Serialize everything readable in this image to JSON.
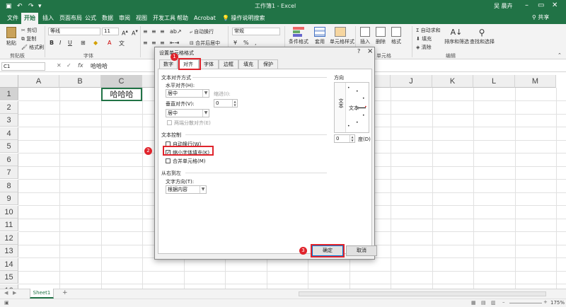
{
  "titlebar": {
    "window_title": "工作簿1 - Excel",
    "user": "吴 晨卉",
    "share": "共享",
    "tell_me": "操作说明搜索",
    "tabs": [
      "文件",
      "开始",
      "插入",
      "页面布局",
      "公式",
      "数据",
      "审阅",
      "视图",
      "开发工具",
      "帮助",
      "Acrobat"
    ]
  },
  "ribbon": {
    "clipboard": {
      "paste": "粘贴",
      "cut": "剪切",
      "copy": "复制",
      "format_painter": "格式刷",
      "group": "剪贴板"
    },
    "font": {
      "name": "等线",
      "size": "11",
      "group": "字体"
    },
    "alignment": {
      "wrap": "自动换行",
      "merge": "合并后居中"
    },
    "number": {
      "format": "常规"
    },
    "styles": {
      "conditional": "条件格式",
      "table": "套用",
      "cell_styles": "单元格样式"
    },
    "cells": {
      "insert": "插入",
      "delete": "删除",
      "format": "格式",
      "group": "单元格"
    },
    "editing": {
      "autosum": "自动求和",
      "fill": "填充",
      "clear": "清除",
      "sort": "排序和筛选",
      "find": "查找和选择",
      "group": "编辑"
    }
  },
  "formula_bar": {
    "name_box": "C1",
    "fx": "fx",
    "content": "哈哈哈"
  },
  "grid": {
    "columns": [
      "A",
      "B",
      "C",
      "D",
      "E",
      "F",
      "G",
      "H",
      "I",
      "J",
      "K",
      "L",
      "M"
    ],
    "rows": [
      "1",
      "2",
      "3",
      "4",
      "5",
      "6",
      "7",
      "8",
      "9",
      "10",
      "11",
      "12",
      "13",
      "14",
      "15",
      "16"
    ],
    "cell_c1": "哈哈哈"
  },
  "sheets": {
    "tab": "Sheet1",
    "add": "+"
  },
  "status": {
    "zoom": "175%"
  },
  "dialog": {
    "title": "设置单元格格式",
    "help": "?",
    "close": "×",
    "tabs": [
      "数字",
      "对齐",
      "字体",
      "边框",
      "填充",
      "保护"
    ],
    "text_alignment": {
      "section": "文本对齐方式",
      "horizontal_label": "水平对齐(H):",
      "horizontal_value": "居中",
      "indent_label": "缩进(I):",
      "indent_value": "0",
      "vertical_label": "垂直对齐(V):",
      "vertical_value": "居中",
      "justify_distributed": "两端分散对齐(E)"
    },
    "orientation": {
      "label": "方向",
      "vertical_text": "文本",
      "rotated_text": "文本",
      "degrees": "度(D)",
      "degree_value": "0"
    },
    "text_control": {
      "section": "文本控制",
      "wrap": "自动换行(W)",
      "shrink": "缩小字体填充(K)",
      "shrink_checked": true,
      "merge": "合并单元格(M)"
    },
    "rtl": {
      "section": "从右到左",
      "direction_label": "文字方向(T):",
      "direction_value": "根据内容"
    },
    "ok": "确定",
    "cancel": "取消",
    "markers": [
      "1",
      "2",
      "3"
    ],
    "highlight_color": "#e0242c"
  }
}
